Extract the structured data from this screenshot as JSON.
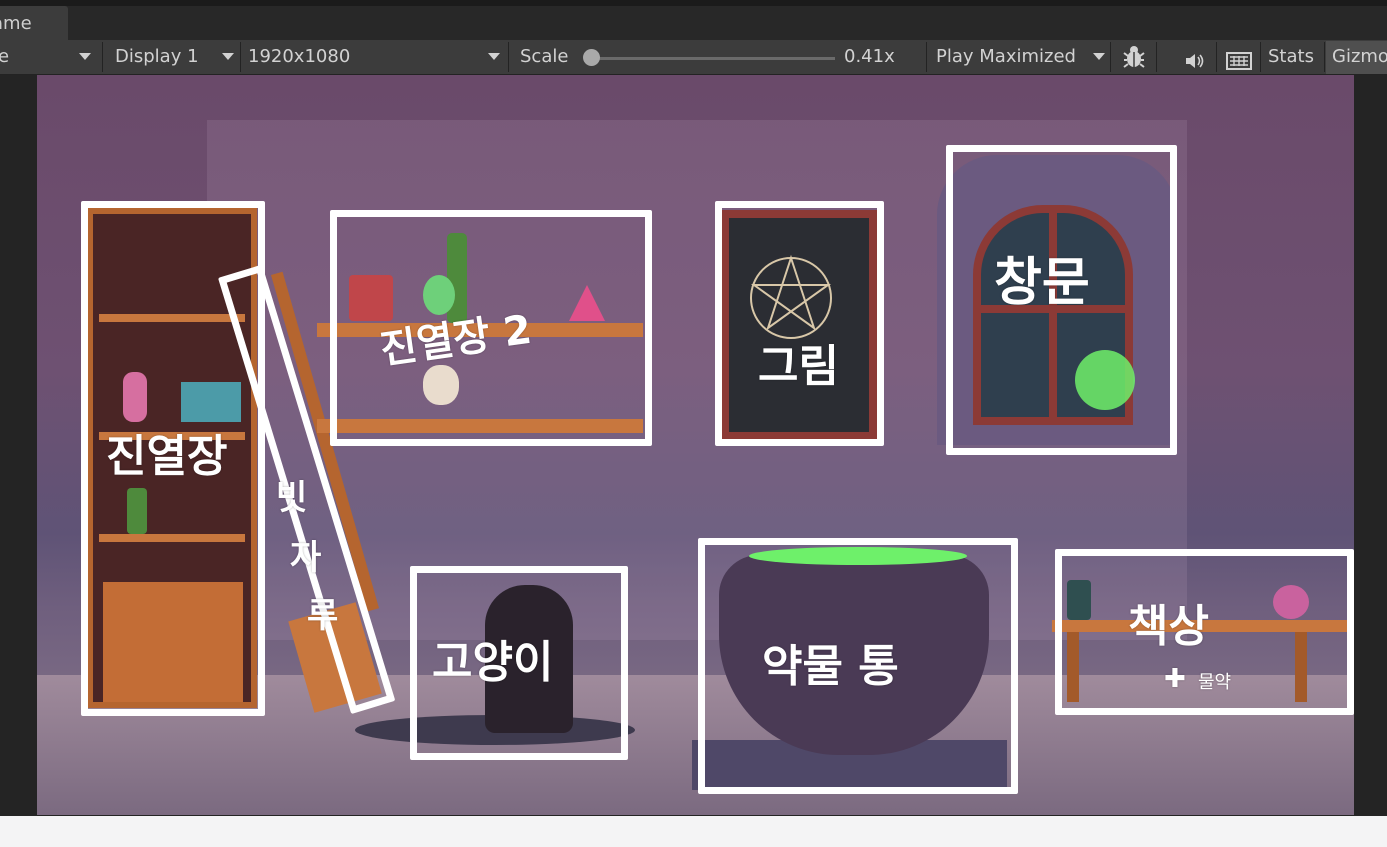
{
  "tab": {
    "label": "ame"
  },
  "toolbar": {
    "view_label": "e",
    "display": "Display 1",
    "resolution": "1920x1080",
    "scale_label": "Scale",
    "scale_value": "0.41x",
    "scale_fraction": 0.0,
    "play_mode": "Play Maximized",
    "stats_label": "Stats",
    "gizmos_label": "Gizmo"
  },
  "icons": [
    "dropdown-caret-icon",
    "bug-icon",
    "audio-icon",
    "keyboard-icon"
  ],
  "annotations": {
    "shelf1": "진열장",
    "broom": [
      "빗",
      "자",
      "루"
    ],
    "shelf2": "진열장 2",
    "painting": "그림",
    "window": "창문",
    "cat": "고양이",
    "cauldron": "약물 통",
    "desk": "책상",
    "desk_note": "물약"
  },
  "colors": {
    "annotation": "#ffffff",
    "toolbar_bg": "#3c3c3c",
    "potion_green": "#6ef06a"
  }
}
